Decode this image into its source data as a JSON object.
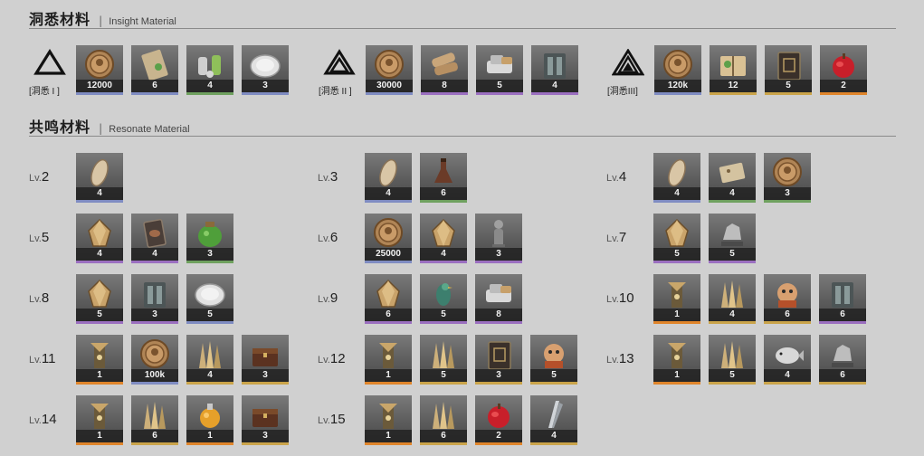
{
  "insight": {
    "title_zh": "洞悉材料",
    "separator": "|",
    "title_en": "Insight Material",
    "tiers": [
      {
        "label": "[洞悉 I ]",
        "items": [
          {
            "icon": "coin-icon",
            "count": "12000",
            "rarity": "blue"
          },
          {
            "icon": "scroll-icon",
            "count": "6",
            "rarity": "blue"
          },
          {
            "icon": "vial-icon",
            "count": "4",
            "rarity": "green"
          },
          {
            "icon": "dish-icon",
            "count": "3",
            "rarity": "blue"
          }
        ]
      },
      {
        "label": "[洞悉 II ]",
        "items": [
          {
            "icon": "coin-icon",
            "count": "30000",
            "rarity": "blue"
          },
          {
            "icon": "scroll-bundle-icon",
            "count": "8",
            "rarity": "purple"
          },
          {
            "icon": "gear-bundle-icon",
            "count": "5",
            "rarity": "purple"
          },
          {
            "icon": "device-icon",
            "count": "4",
            "rarity": "purple"
          }
        ]
      },
      {
        "label": "[洞悉III]",
        "items": [
          {
            "icon": "coin-icon",
            "count": "120k",
            "rarity": "blue"
          },
          {
            "icon": "book-icon",
            "count": "12",
            "rarity": "gold"
          },
          {
            "icon": "tome-icon",
            "count": "5",
            "rarity": "gold"
          },
          {
            "icon": "apple-icon",
            "count": "2",
            "rarity": "orange"
          }
        ]
      }
    ]
  },
  "resonate": {
    "title_zh": "共鸣材料",
    "separator": "|",
    "title_en": "Resonate Material",
    "levels": [
      {
        "lv_prefix": "Lv.",
        "lv": "2",
        "items": [
          {
            "icon": "seed-icon",
            "count": "4",
            "rarity": "blue"
          }
        ]
      },
      {
        "lv_prefix": "Lv.",
        "lv": "3",
        "items": [
          {
            "icon": "seed-icon",
            "count": "4",
            "rarity": "blue"
          },
          {
            "icon": "flask-icon",
            "count": "6",
            "rarity": "green"
          }
        ]
      },
      {
        "lv_prefix": "Lv.",
        "lv": "4",
        "items": [
          {
            "icon": "seed-icon",
            "count": "4",
            "rarity": "blue"
          },
          {
            "icon": "paper-icon",
            "count": "4",
            "rarity": "green"
          },
          {
            "icon": "coin-icon",
            "count": "3",
            "rarity": "green"
          }
        ]
      },
      {
        "lv_prefix": "Lv.",
        "lv": "5",
        "items": [
          {
            "icon": "crystal-icon",
            "count": "4",
            "rarity": "purple"
          },
          {
            "icon": "card-icon",
            "count": "4",
            "rarity": "purple"
          },
          {
            "icon": "jar-icon",
            "count": "3",
            "rarity": "green"
          }
        ]
      },
      {
        "lv_prefix": "Lv.",
        "lv": "6",
        "items": [
          {
            "icon": "coin-icon",
            "count": "25000",
            "rarity": "blue"
          },
          {
            "icon": "crystal-icon",
            "count": "4",
            "rarity": "purple"
          },
          {
            "icon": "figure-icon",
            "count": "3",
            "rarity": "purple"
          }
        ]
      },
      {
        "lv_prefix": "Lv.",
        "lv": "7",
        "items": [
          {
            "icon": "crystal-icon",
            "count": "5",
            "rarity": "purple"
          },
          {
            "icon": "statue-icon",
            "count": "5",
            "rarity": "purple"
          }
        ]
      },
      {
        "lv_prefix": "Lv.",
        "lv": "8",
        "items": [
          {
            "icon": "crystal-icon",
            "count": "5",
            "rarity": "purple"
          },
          {
            "icon": "device-icon",
            "count": "3",
            "rarity": "purple"
          },
          {
            "icon": "dish-icon",
            "count": "5",
            "rarity": "blue"
          }
        ]
      },
      {
        "lv_prefix": "Lv.",
        "lv": "9",
        "items": [
          {
            "icon": "crystal-icon",
            "count": "6",
            "rarity": "purple"
          },
          {
            "icon": "bird-icon",
            "count": "5",
            "rarity": "purple"
          },
          {
            "icon": "gear-bundle-icon",
            "count": "8",
            "rarity": "purple"
          }
        ]
      },
      {
        "lv_prefix": "Lv.",
        "lv": "10",
        "items": [
          {
            "icon": "totem-icon",
            "count": "1",
            "rarity": "orange"
          },
          {
            "icon": "shard-icon",
            "count": "4",
            "rarity": "gold"
          },
          {
            "icon": "mask-icon",
            "count": "6",
            "rarity": "gold"
          },
          {
            "icon": "device-icon",
            "count": "6",
            "rarity": "purple"
          }
        ]
      },
      {
        "lv_prefix": "Lv.",
        "lv": "11",
        "items": [
          {
            "icon": "totem-icon",
            "count": "1",
            "rarity": "orange"
          },
          {
            "icon": "coin-icon",
            "count": "100k",
            "rarity": "blue"
          },
          {
            "icon": "shard-icon",
            "count": "4",
            "rarity": "gold"
          },
          {
            "icon": "chest-icon",
            "count": "3",
            "rarity": "gold"
          }
        ]
      },
      {
        "lv_prefix": "Lv.",
        "lv": "12",
        "items": [
          {
            "icon": "totem-icon",
            "count": "1",
            "rarity": "orange"
          },
          {
            "icon": "shard-icon",
            "count": "5",
            "rarity": "gold"
          },
          {
            "icon": "tome-icon",
            "count": "3",
            "rarity": "gold"
          },
          {
            "icon": "mask-icon",
            "count": "5",
            "rarity": "gold"
          }
        ]
      },
      {
        "lv_prefix": "Lv.",
        "lv": "13",
        "items": [
          {
            "icon": "totem-icon",
            "count": "1",
            "rarity": "orange"
          },
          {
            "icon": "shard-icon",
            "count": "5",
            "rarity": "gold"
          },
          {
            "icon": "fish-icon",
            "count": "4",
            "rarity": "gold"
          },
          {
            "icon": "statue-icon",
            "count": "6",
            "rarity": "gold"
          }
        ]
      },
      {
        "lv_prefix": "Lv.",
        "lv": "14",
        "items": [
          {
            "icon": "totem-icon",
            "count": "1",
            "rarity": "orange"
          },
          {
            "icon": "shard-icon",
            "count": "6",
            "rarity": "gold"
          },
          {
            "icon": "potion-icon",
            "count": "1",
            "rarity": "orange"
          },
          {
            "icon": "chest-icon",
            "count": "3",
            "rarity": "gold"
          }
        ]
      },
      {
        "lv_prefix": "Lv.",
        "lv": "15",
        "items": [
          {
            "icon": "totem-icon",
            "count": "1",
            "rarity": "orange"
          },
          {
            "icon": "shard-icon",
            "count": "6",
            "rarity": "gold"
          },
          {
            "icon": "apple-icon",
            "count": "2",
            "rarity": "orange"
          },
          {
            "icon": "blade-icon",
            "count": "4",
            "rarity": "gold"
          }
        ]
      }
    ]
  }
}
